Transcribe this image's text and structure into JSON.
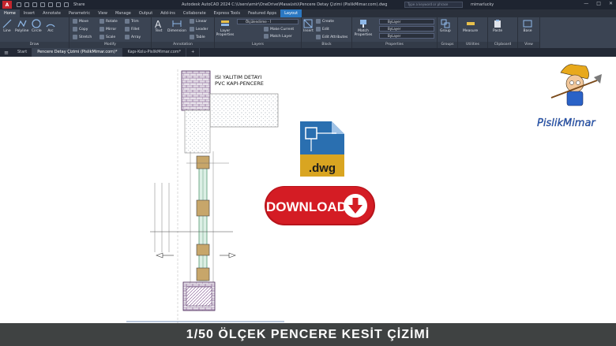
{
  "title_bar": {
    "app_letter": "A",
    "share_label": "Share",
    "window_title": "Autodesk AutoCAD 2024   C:\\Users\\emir\\OneDrive\\Masaüstü\\Pencere Detay Çizimi (PislikMimar.com).dwg",
    "search_placeholder": "Type a keyword or phrase",
    "user": "mimarlucky",
    "controls": [
      "—",
      "□",
      "✕"
    ]
  },
  "ribbon_tabs": [
    {
      "label": "Home",
      "active": true
    },
    {
      "label": "Insert"
    },
    {
      "label": "Annotate"
    },
    {
      "label": "Parametric"
    },
    {
      "label": "View"
    },
    {
      "label": "Manage"
    },
    {
      "label": "Output"
    },
    {
      "label": "Add-ins"
    },
    {
      "label": "Collaborate"
    },
    {
      "label": "Express Tools"
    },
    {
      "label": "Featured Apps"
    },
    {
      "label": "Layout",
      "special": true
    }
  ],
  "ribbon": {
    "draw": {
      "title": "Draw",
      "line": "Line",
      "polyline": "Polyline",
      "circle": "Circle",
      "arc": "Arc"
    },
    "modify": {
      "title": "Modify",
      "move": "Move",
      "rotate": "Rotate",
      "trim": "Trim",
      "copy": "Copy",
      "mirror": "Mirror",
      "fillet": "Fillet",
      "stretch": "Stretch",
      "scale": "Scale",
      "array": "Array"
    },
    "annotation": {
      "title": "Annotation",
      "text": "Text",
      "dimension": "Dimension",
      "linear": "Linear",
      "leader": "Leader",
      "table": "Table"
    },
    "layers": {
      "title": "Layers",
      "layer_properties": "Layer Properties",
      "current_layer": "Ölçülendirme - İ",
      "make_current": "Make Current",
      "match_layer": "Match Layer"
    },
    "block": {
      "title": "Block",
      "insert": "Insert",
      "create": "Create",
      "edit": "Edit",
      "edit_attributes": "Edit Attributes"
    },
    "properties": {
      "title": "Properties",
      "match": "Match Properties",
      "by_layer_1": "ByLayer",
      "by_layer_2": "ByLayer",
      "by_layer_3": "ByLayer"
    },
    "groups": {
      "title": "Groups",
      "group": "Group"
    },
    "utilities": {
      "title": "Utilities",
      "measure": "Measure"
    },
    "clipboard": {
      "title": "Clipboard",
      "paste": "Paste"
    },
    "view": {
      "title": "View",
      "base": "Base"
    }
  },
  "doc_tabs": [
    {
      "label": "Start"
    },
    {
      "label": "Pencere Detay Çizimi (PislikMimar.com)*",
      "active": true
    },
    {
      "label": "Kapı-Kolu-PislikMimar.com*"
    },
    {
      "label": "+"
    }
  ],
  "drawing": {
    "title_line1": "ISI YALITIM DETAYI",
    "title_line2": "PVC KAPI-PENCERE",
    "dwg_label": ".dwg",
    "download_label": "DOWNLOAD",
    "logo_text": "PislikMimar"
  },
  "banner": {
    "text": "1/50 ÖLÇEK PENCERE KESİT ÇİZİMİ"
  },
  "colors": {
    "download_red": "#d41c24",
    "dwg_gold": "#d9a521",
    "dwg_blue": "#2a6fb0",
    "banner_bg": "#3f4242"
  }
}
